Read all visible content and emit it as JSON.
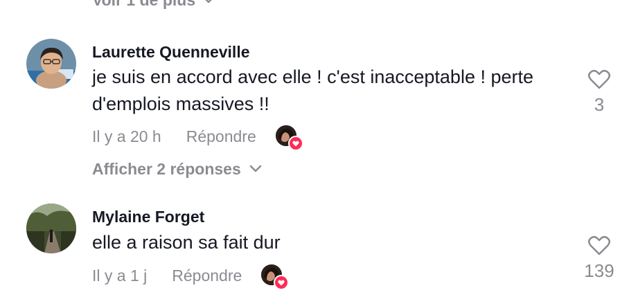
{
  "top_more": {
    "label": "Voir 1 de plus"
  },
  "comments": [
    {
      "author": "Laurette Quenneville",
      "text": "je suis en accord avec elle ! c'est inacceptable ! perte d'emplois massives !!",
      "time": "Il y a 20 h",
      "reply_label": "Répondre",
      "likes": "3",
      "view_replies": "Afficher 2 réponses"
    },
    {
      "author": "Mylaine Forget",
      "text": "elle a raison sa fait dur",
      "time": "Il y a 1 j",
      "reply_label": "Répondre",
      "likes": "139"
    }
  ],
  "colors": {
    "text": "#161823",
    "muted": "#8a8b91",
    "heart_badge": "#fe2c55"
  }
}
